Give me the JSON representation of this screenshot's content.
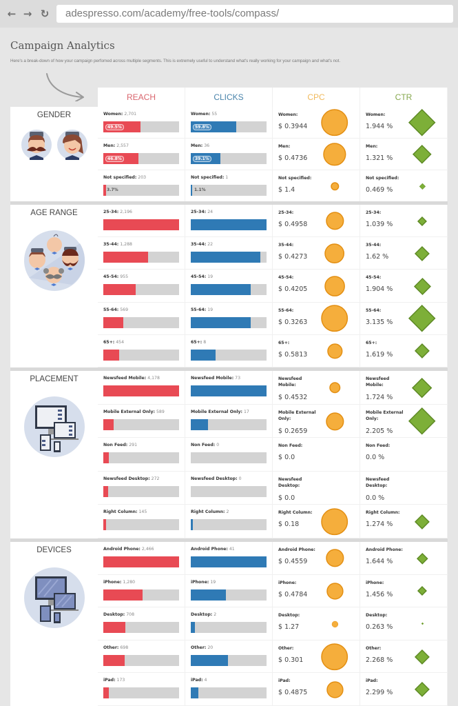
{
  "browser": {
    "back_icon": "arrow-left-icon",
    "forward_icon": "arrow-right-icon",
    "reload_icon": "reload-icon",
    "back_glyph": "←",
    "forward_glyph": "→",
    "reload_glyph": "↻",
    "url": "adespresso.com/academy/free-tools/compass/"
  },
  "page": {
    "title": "Campaign Analytics",
    "subtitle": "Here's a break-down of how your campaign perfomed across multiple segments. This is extremely useful to understand what's really working for your campaign and what's not."
  },
  "colors": {
    "reach": "#e84a54",
    "clicks": "#2f7ab5",
    "cpc": "#f5ae3c",
    "cpc_border": "#e38f13",
    "ctr": "#7daf38",
    "ctr_border": "#5e8a25",
    "reach_header": "#d9656d",
    "clicks_header": "#4a84ab",
    "cpc_header": "#f0b95c",
    "ctr_header": "#86a84e"
  },
  "columns": [
    "REACH",
    "CLICKS",
    "CPC",
    "CTR"
  ],
  "sections": [
    {
      "title": "GENDER",
      "illustration": "gender-avatars-illustration",
      "rows": [
        {
          "label": "Women:",
          "reach": "2,701",
          "reach_frac": 0.495,
          "reach_pct": "49.5%",
          "clicks": "55",
          "clicks_frac": 0.598,
          "clicks_pct": "59.8%",
          "cpc": "$ 0.3944",
          "cpc_size": 0.85,
          "ctr": "1.944 %",
          "ctr_size": 0.85
        },
        {
          "label": "Men:",
          "reach": "2,557",
          "reach_frac": 0.468,
          "reach_pct": "46.8%",
          "clicks": "36",
          "clicks_frac": 0.391,
          "clicks_pct": "39.1%",
          "cpc": "$ 0.4736",
          "cpc_size": 0.72,
          "ctr": "1.321 %",
          "ctr_size": 0.58
        },
        {
          "label": "Not specified:",
          "reach": "203",
          "reach_frac": 0.037,
          "reach_pct": "3.7%",
          "clicks": "1",
          "clicks_frac": 0.011,
          "clicks_pct": "1.1%",
          "cpc": "$ 1.4",
          "cpc_size": 0.24,
          "ctr": "0.469 %",
          "ctr_size": 0.2
        }
      ]
    },
    {
      "title": "AGE RANGE",
      "illustration": "age-range-avatars-illustration",
      "rows": [
        {
          "label": "25-34:",
          "reach": "2,196",
          "reach_frac": 1.0,
          "clicks": "24",
          "clicks_frac": 1.0,
          "cpc": "$ 0.4958",
          "cpc_size": 0.56,
          "ctr": "1.039 %",
          "ctr_size": 0.27
        },
        {
          "label": "35-44:",
          "reach": "1,288",
          "reach_frac": 0.59,
          "clicks": "22",
          "clicks_frac": 0.92,
          "cpc": "$ 0.4273",
          "cpc_size": 0.62,
          "ctr": "1.62 %",
          "ctr_size": 0.45
        },
        {
          "label": "45-54:",
          "reach": "955",
          "reach_frac": 0.43,
          "clicks": "19",
          "clicks_frac": 0.79,
          "cpc": "$ 0.4205",
          "cpc_size": 0.64,
          "ctr": "1.904 %",
          "ctr_size": 0.52
        },
        {
          "label": "55-64:",
          "reach": "569",
          "reach_frac": 0.26,
          "clicks": "19",
          "clicks_frac": 0.79,
          "cpc": "$ 0.3263",
          "cpc_size": 0.85,
          "ctr": "3.135 %",
          "ctr_size": 0.85
        },
        {
          "label": "65+:",
          "reach": "454",
          "reach_frac": 0.21,
          "clicks": "8",
          "clicks_frac": 0.33,
          "cpc": "$ 0.5813",
          "cpc_size": 0.47,
          "ctr": "1.619 %",
          "ctr_size": 0.45
        }
      ]
    },
    {
      "title": "PLACEMENT",
      "illustration": "placement-devices-illustration",
      "rows": [
        {
          "label": "Newsfeed Mobile:",
          "reach": "4,178",
          "reach_frac": 1.0,
          "clicks": "73",
          "clicks_frac": 1.0,
          "cpc": "$ 0.4532",
          "cpc_size": 0.33,
          "ctr": "1.724 %",
          "ctr_size": 0.62
        },
        {
          "label": "Mobile External Only:",
          "reach": "589",
          "reach_frac": 0.14,
          "clicks": "17",
          "clicks_frac": 0.23,
          "cpc": "$ 0.2659",
          "cpc_size": 0.56,
          "ctr": "2.205 %",
          "ctr_size": 0.85
        },
        {
          "label": "Non Feed:",
          "reach": "291",
          "reach_frac": 0.07,
          "clicks": "0",
          "clicks_frac": 0.0,
          "cpc": "$ 0.0",
          "cpc_size": 0,
          "ctr": "0.0 %",
          "ctr_size": 0
        },
        {
          "label": "Newsfeed Desktop:",
          "reach": "272",
          "reach_frac": 0.065,
          "clicks": "0",
          "clicks_frac": 0.0,
          "cpc": "$ 0.0",
          "cpc_size": 0,
          "ctr": "0.0 %",
          "ctr_size": 0
        },
        {
          "label": "Right Column:",
          "reach": "145",
          "reach_frac": 0.035,
          "clicks": "2",
          "clicks_frac": 0.027,
          "cpc": "$ 0.18",
          "cpc_size": 0.85,
          "ctr": "1.274 %",
          "ctr_size": 0.45
        }
      ]
    },
    {
      "title": "DEVICES",
      "illustration": "devices-illustration",
      "rows": [
        {
          "label": "Android Phone:",
          "reach": "2,466",
          "reach_frac": 1.0,
          "clicks": "41",
          "clicks_frac": 1.0,
          "cpc": "$ 0.4559",
          "cpc_size": 0.56,
          "ctr": "1.644 %",
          "ctr_size": 0.33
        },
        {
          "label": "iPhone:",
          "reach": "1,280",
          "reach_frac": 0.52,
          "clicks": "19",
          "clicks_frac": 0.46,
          "cpc": "$ 0.4784",
          "cpc_size": 0.52,
          "ctr": "1.456 %",
          "ctr_size": 0.27
        },
        {
          "label": "Desktop:",
          "reach": "708",
          "reach_frac": 0.29,
          "clicks": "2",
          "clicks_frac": 0.05,
          "cpc": "$ 1.27",
          "cpc_size": 0.2,
          "ctr": "0.263 %",
          "ctr_size": 0.04
        },
        {
          "label": "Other:",
          "reach": "698",
          "reach_frac": 0.28,
          "clicks": "20",
          "clicks_frac": 0.49,
          "cpc": "$ 0.301",
          "cpc_size": 0.85,
          "ctr": "2.268 %",
          "ctr_size": 0.45
        },
        {
          "label": "iPad:",
          "reach": "173",
          "reach_frac": 0.07,
          "clicks": "4",
          "clicks_frac": 0.1,
          "cpc": "$ 0.4875",
          "cpc_size": 0.52,
          "ctr": "2.299 %",
          "ctr_size": 0.45
        }
      ]
    }
  ]
}
